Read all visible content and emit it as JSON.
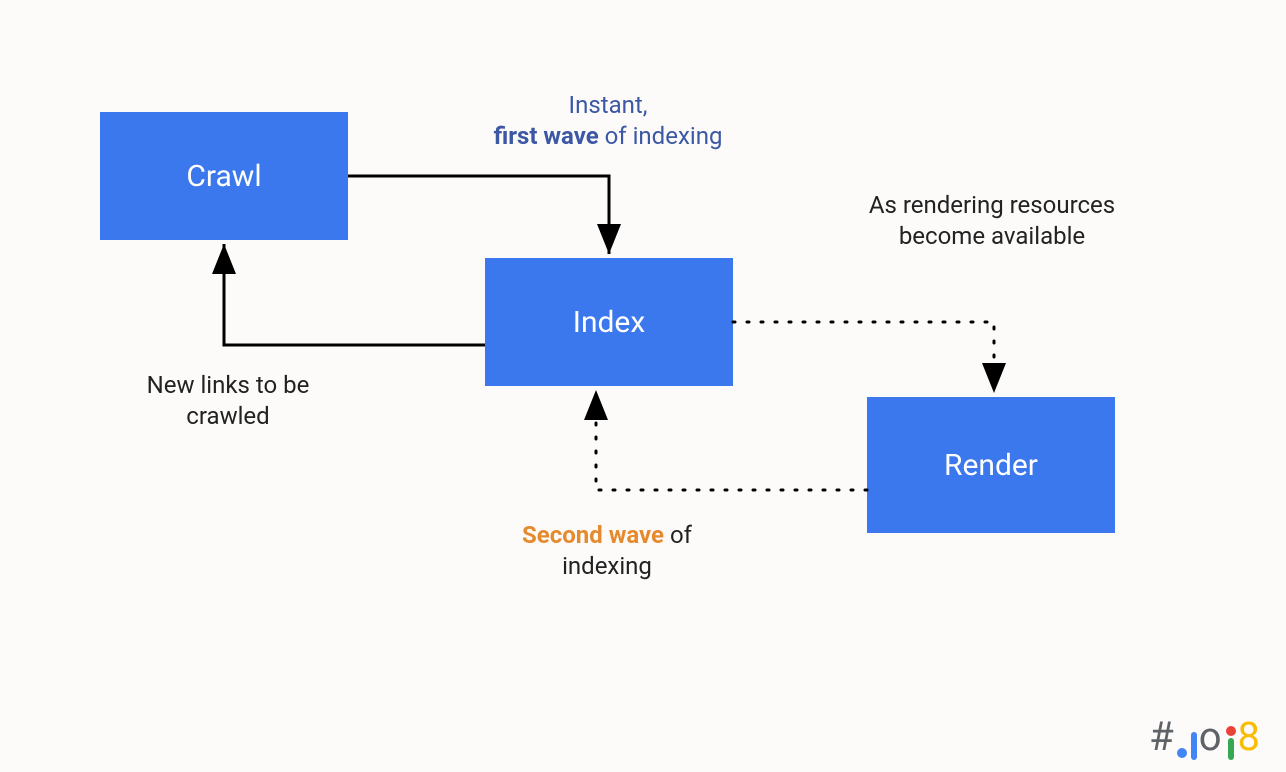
{
  "nodes": {
    "crawl": {
      "label": "Crawl"
    },
    "index": {
      "label": "Index"
    },
    "render": {
      "label": "Render"
    }
  },
  "labels": {
    "first_wave_line1": "Instant,",
    "first_wave_bold": "first wave",
    "first_wave_rest": " of indexing",
    "new_links": "New links to be crawled",
    "resources": "As rendering resources become available",
    "second_wave_bold": "Second wave",
    "second_wave_rest": " of indexing"
  },
  "watermark": {
    "hash": "#",
    "text_after": "io",
    "year_digit": "8"
  },
  "colors": {
    "box_bg": "#3b77ed",
    "box_text": "#ffffff",
    "first_wave": "#3c58a4",
    "second_wave": "#e68a2e",
    "arrow": "#000000"
  },
  "chart_data": {
    "type": "diagram",
    "title": "Google crawl / index / render two-wave indexing",
    "nodes": [
      "Crawl",
      "Index",
      "Render"
    ],
    "edges": [
      {
        "from": "Crawl",
        "to": "Index",
        "style": "solid",
        "label": "Instant, first wave of indexing"
      },
      {
        "from": "Index",
        "to": "Crawl",
        "style": "solid",
        "label": "New links to be crawled"
      },
      {
        "from": "Index",
        "to": "Render",
        "style": "dotted",
        "label": "As rendering resources become available"
      },
      {
        "from": "Render",
        "to": "Index",
        "style": "dotted",
        "label": "Second wave of indexing"
      }
    ]
  }
}
